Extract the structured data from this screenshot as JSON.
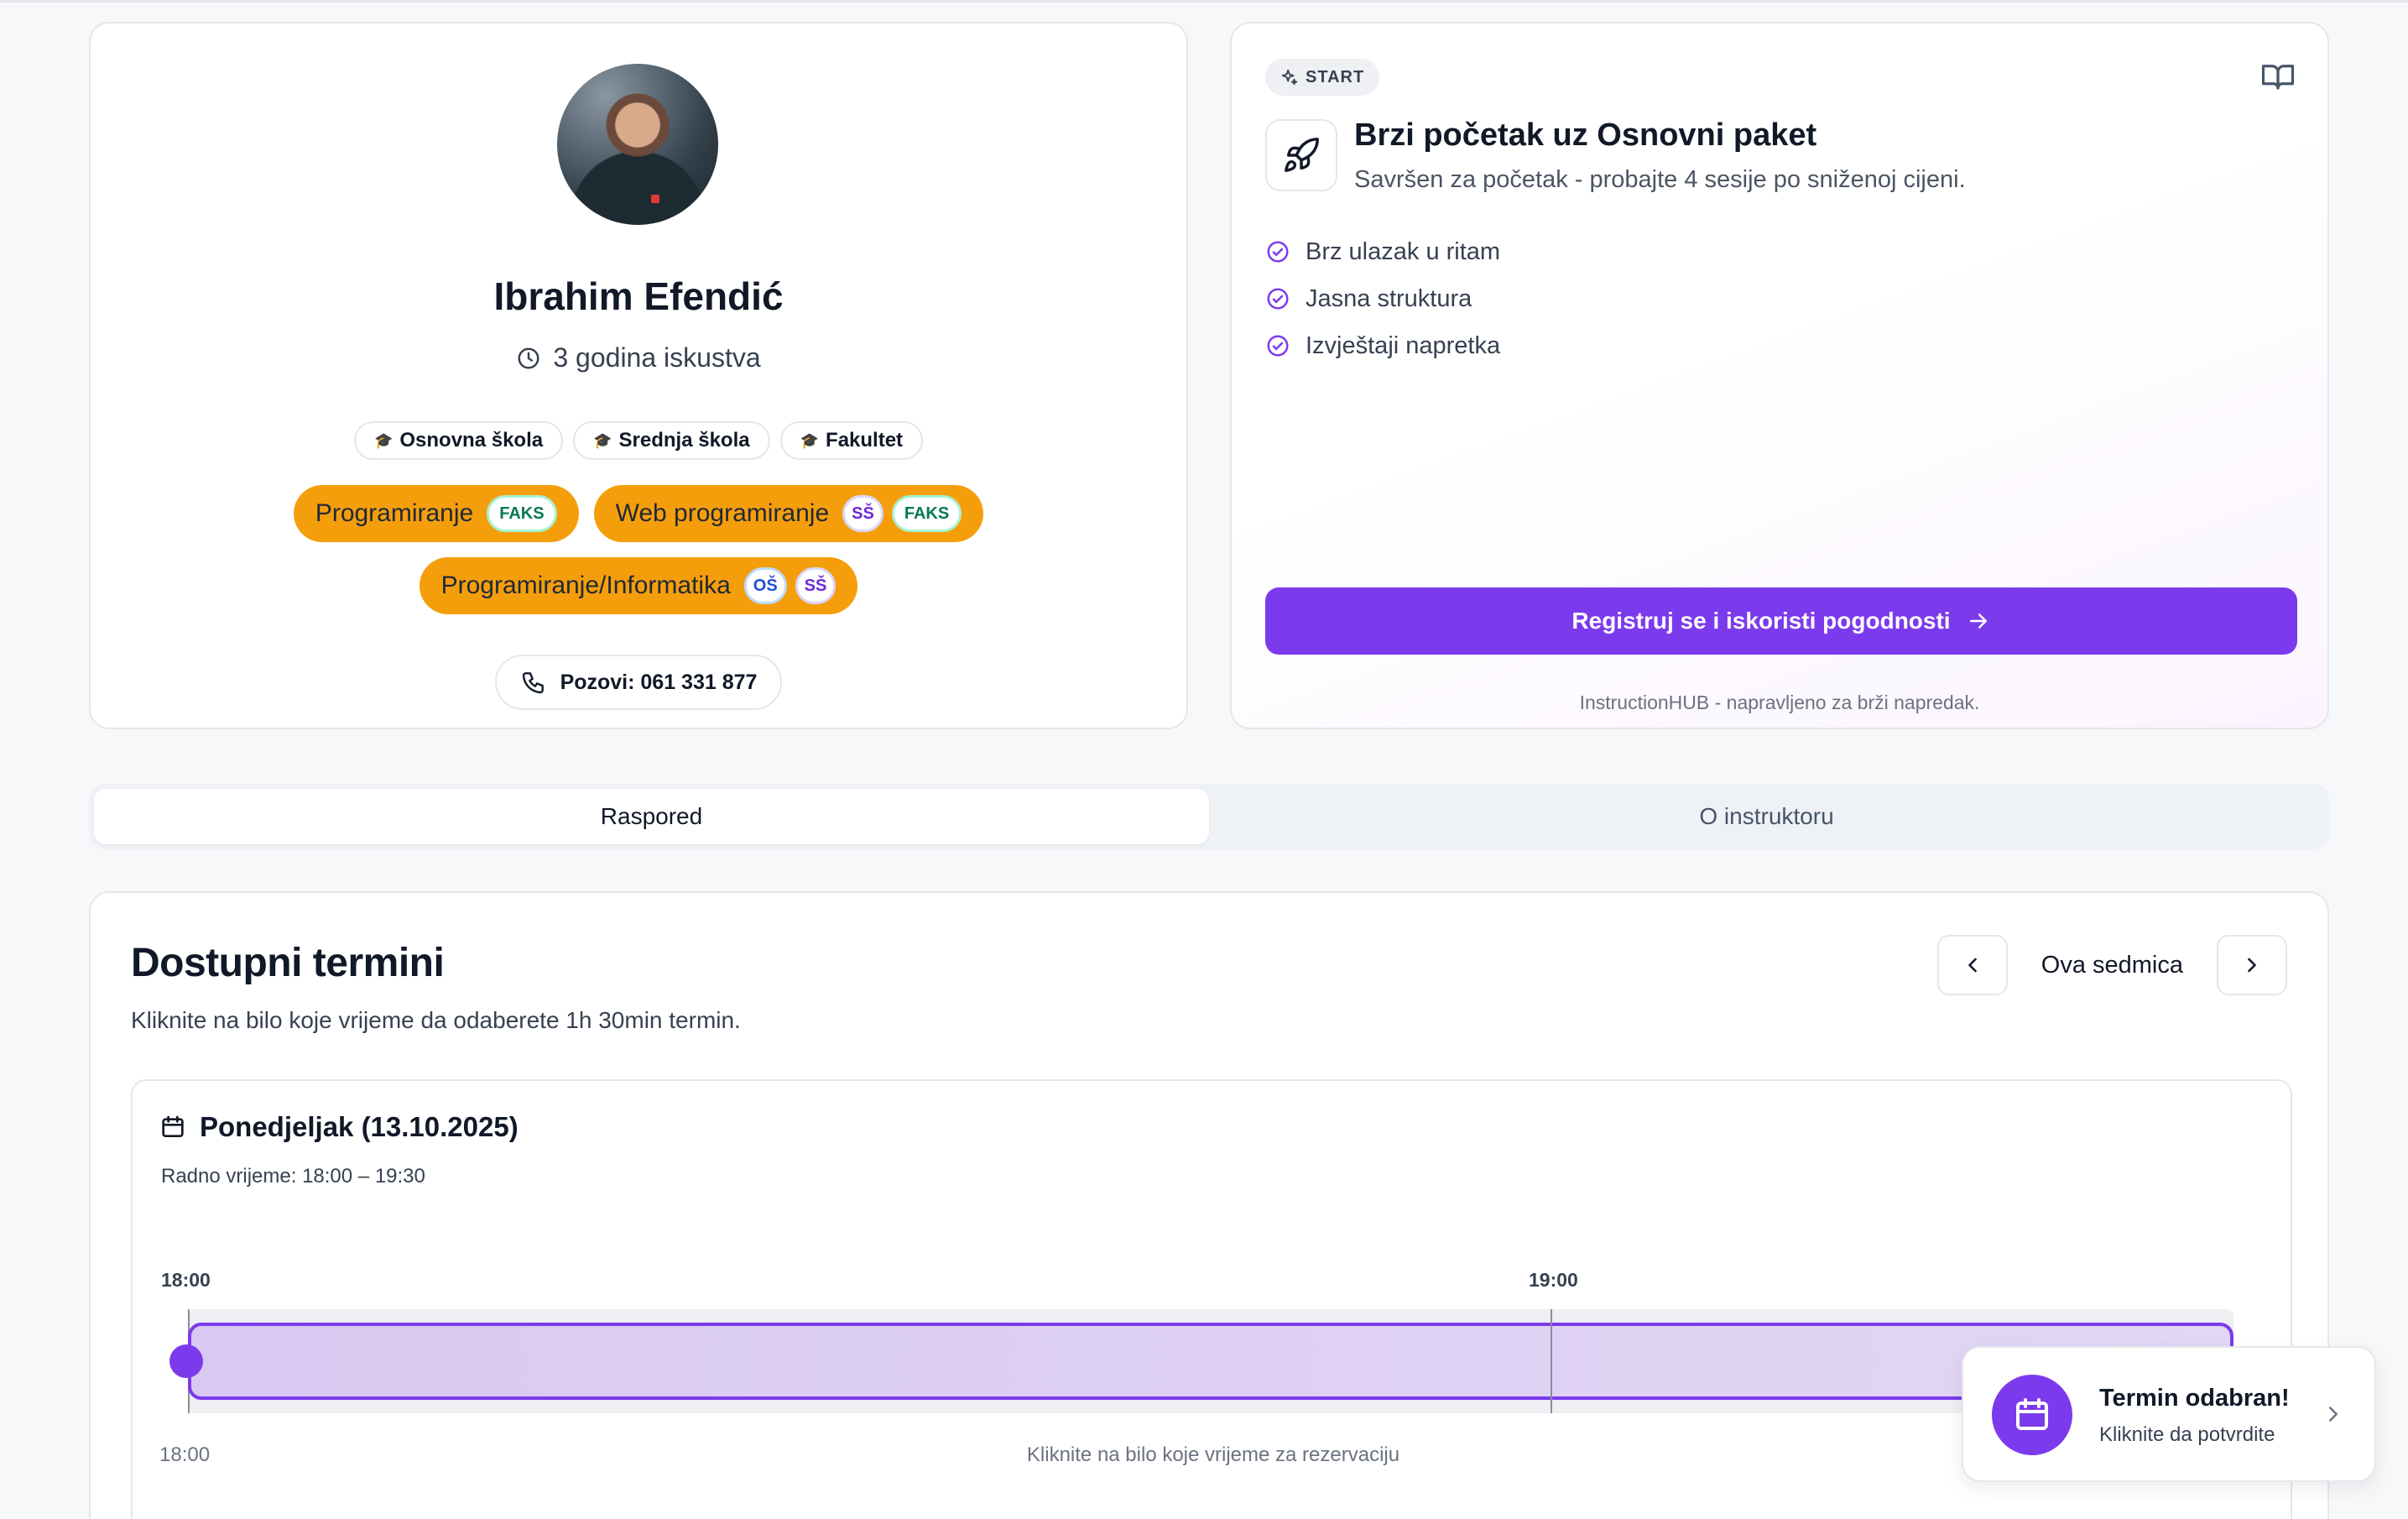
{
  "profile": {
    "name": "Ibrahim Efendić",
    "experience": "3 godina iskustva",
    "levels": [
      "Osnovna škola",
      "Srednja škola",
      "Fakultet"
    ],
    "subjects_row1": [
      {
        "label": "Programiranje",
        "tags": [
          "FAKS"
        ]
      },
      {
        "label": "Web programiranje",
        "tags": [
          "SŠ",
          "FAKS"
        ]
      }
    ],
    "subjects_row2": [
      {
        "label": "Programiranje/Informatika",
        "tags": [
          "OŠ",
          "SŠ"
        ]
      }
    ],
    "call_label": "Pozovi: 061 331 877"
  },
  "promo": {
    "badge": "START",
    "title": "Brzi početak uz Osnovni paket",
    "subtitle": "Savršen za početak - probajte 4 sesije po sniženoj cijeni.",
    "benefits": [
      "Brz ulazak u ritam",
      "Jasna struktura",
      "Izvještaji napretka"
    ],
    "cta": "Registruj se i iskoristi pogodnosti",
    "footer": "InstructionHUB - napravljeno za brži napredak."
  },
  "tabs": [
    {
      "label": "Raspored",
      "active": true
    },
    {
      "label": "O instruktoru",
      "active": false
    }
  ],
  "schedule": {
    "title": "Dostupni termini",
    "subtitle": "Kliknite na bilo koje vrijeme da odaberete 1h 30min termin.",
    "week_label": "Ova sedmica",
    "day": {
      "title": "Ponedjeljak (13.10.2025)",
      "work_hours": "Radno vrijeme: 18:00 – 19:30",
      "time_marks": [
        "18:00",
        "19:00"
      ],
      "footer_time": "18:00",
      "footer_hint": "Kliknite na bilo koje vrijeme za rezervaciju"
    }
  },
  "toast": {
    "title": "Termin odabran!",
    "subtitle": "Kliknite da potvrdite"
  },
  "colors": {
    "accent": "#7c3aed",
    "subject_chip": "#f59e0b"
  }
}
